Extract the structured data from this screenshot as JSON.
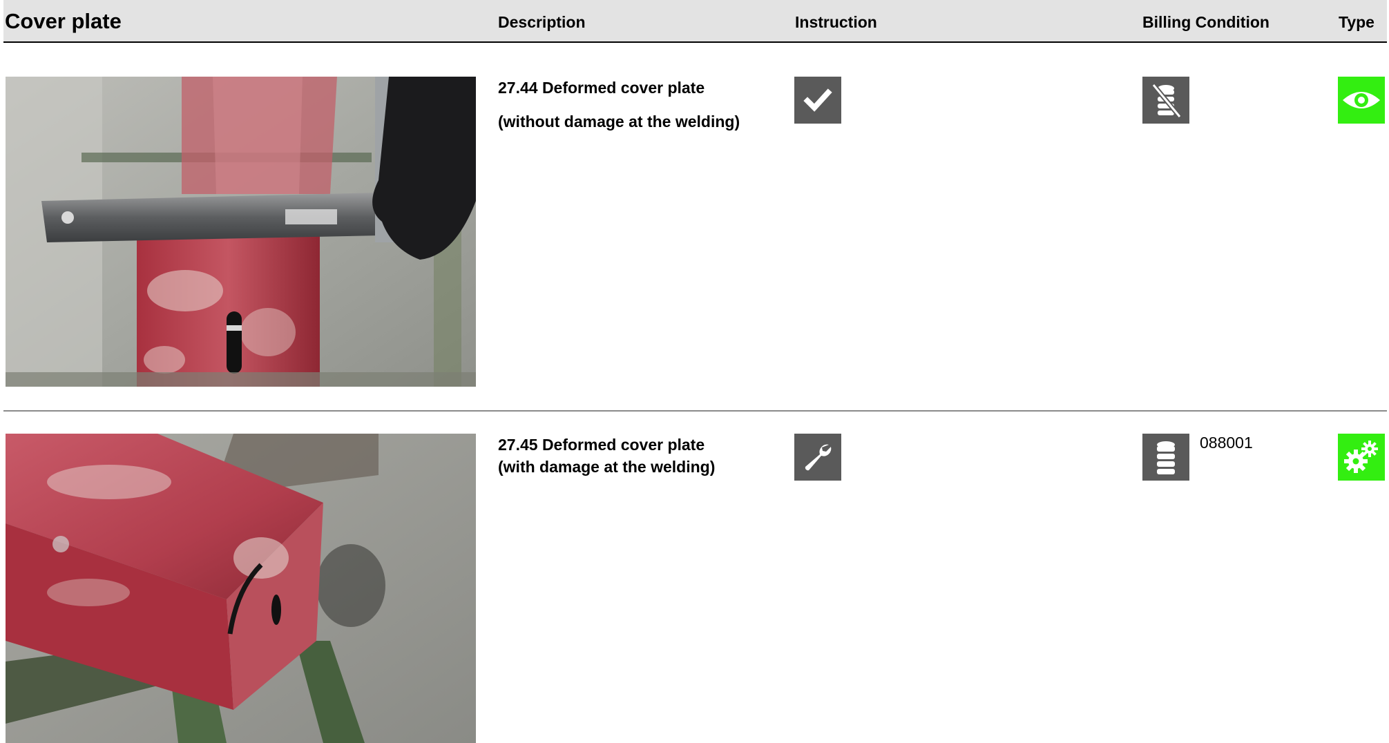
{
  "header": {
    "title": "Cover plate",
    "col_description": "Description",
    "col_instruction": "Instruction",
    "col_billing": "Billing Condition",
    "col_type": "Type"
  },
  "items": [
    {
      "description_line1": "27.44 Deformed cover plate",
      "description_line2": "(without damage at the welding)",
      "instruction_icon": "checkmark-icon",
      "billing_icon": "no-coins-icon",
      "billing_code": "",
      "type_icon": "eye-icon",
      "type_color": "#33ee11"
    },
    {
      "description_line1": "27.45 Deformed cover plate",
      "description_line2": "(with damage at the welding)",
      "instruction_icon": "wrench-icon",
      "billing_icon": "coins-icon",
      "billing_code": "088001",
      "type_icon": "gears-icon",
      "type_color": "#33ee11"
    }
  ],
  "colors": {
    "header_bg": "#e3e3e3",
    "icon_bg": "#5a5a5a",
    "type_green": "#33ee11"
  }
}
